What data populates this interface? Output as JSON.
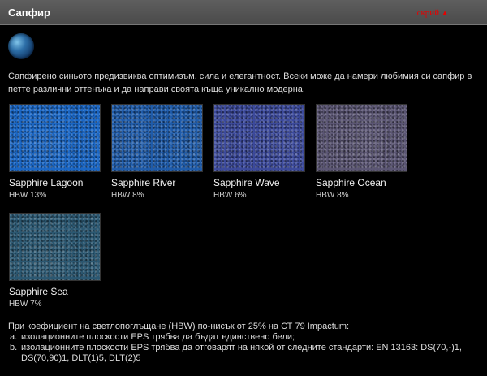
{
  "header": {
    "title": "Сапфир",
    "hide_label": "скрий",
    "hide_arrow": "▲"
  },
  "intro_text": "Сапфирено синьото предизвиква оптимизъм, сила и елегантност. Всеки може да намери любимия си сапфир в петте различни оттенъка и да направи своята къща уникално модерна.",
  "swatches": [
    {
      "name": "Sapphire Lagoon",
      "hbw": "HBW 13%",
      "color": "#1a67c6"
    },
    {
      "name": "Sapphire River",
      "hbw": "HBW 8%",
      "color": "#1f5cab"
    },
    {
      "name": "Sapphire Wave",
      "hbw": "HBW 6%",
      "color": "#3c4a9c"
    },
    {
      "name": "Sapphire Ocean",
      "hbw": "HBW 8%",
      "color": "#5b5674"
    },
    {
      "name": "Sapphire Sea",
      "hbw": "HBW 7%",
      "color": "#2b5872"
    }
  ],
  "note": {
    "intro": "При коефициент на светлопоглъщане (HBW) по-нисък от 25% на СТ 79 Impactum:",
    "items": [
      {
        "mark": "a.",
        "text": "изолационните плоскости EPS трябва да бъдат единствено бели;"
      },
      {
        "mark": "b.",
        "text": "изолационните плоскости EPS трябва да отговарят на някой от следните стандарти: EN 13163: DS(70,-)1, DS(70,90)1, DLT(1)5, DLT(2)5"
      }
    ]
  },
  "colors": {
    "header_bg": "#555555",
    "hide_link": "#e60000",
    "page_bg": "#000000"
  }
}
